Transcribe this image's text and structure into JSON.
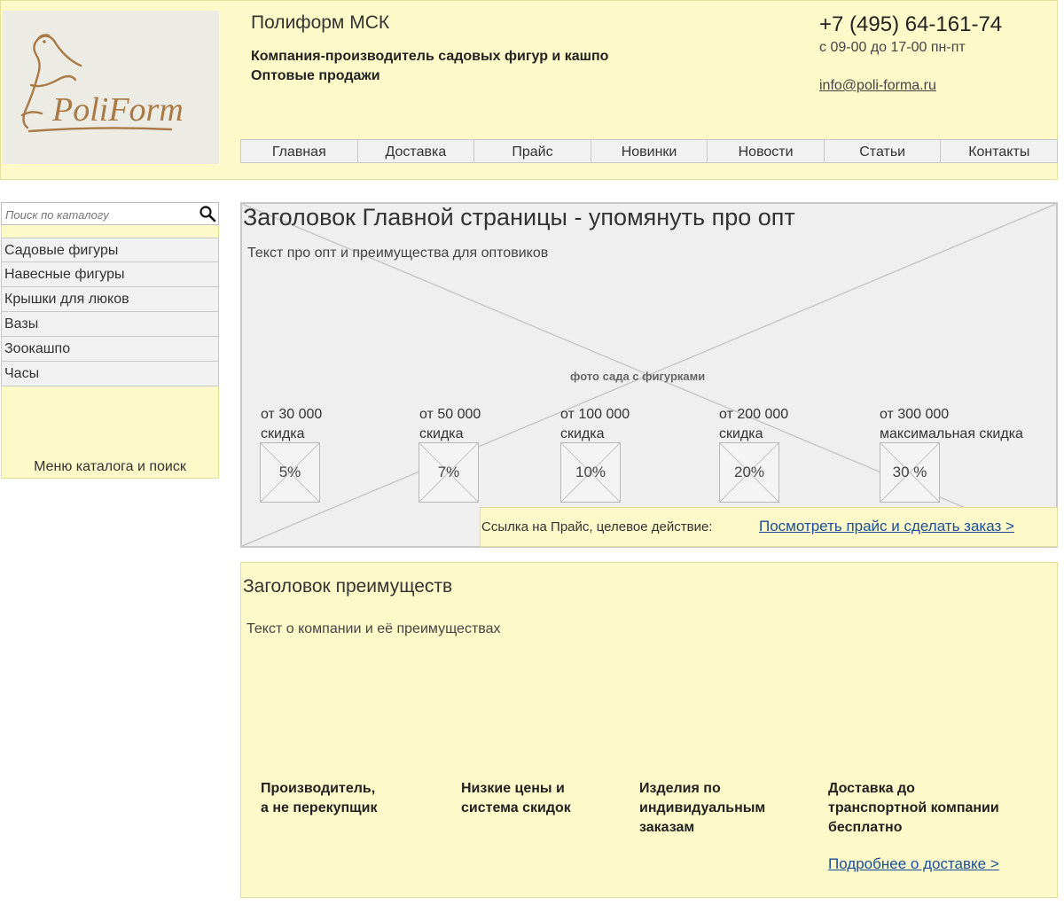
{
  "header": {
    "logo_text": "PoliForm",
    "company_name": "Полиформ МСК",
    "tagline_line1": "Компания-производитель садовых фигур и кашпо",
    "tagline_line2": "Оптовые продажи",
    "phone": "+7 (495) 64-161-74",
    "hours": "с 09-00 до 17-00 пн-пт",
    "email": "info@poli-forma.ru",
    "nav": [
      {
        "label": "Главная"
      },
      {
        "label": "Доставка"
      },
      {
        "label": "Прайс"
      },
      {
        "label": "Новинки"
      },
      {
        "label": "Новости"
      },
      {
        "label": "Статьи"
      },
      {
        "label": "Контакты"
      }
    ]
  },
  "sidebar": {
    "search_placeholder": "Поиск по каталогу",
    "items": [
      {
        "label": "Садовые фигуры"
      },
      {
        "label": "Навесные фигуры"
      },
      {
        "label": "Крышки для люков"
      },
      {
        "label": "Вазы"
      },
      {
        "label": "Зоокашпо"
      },
      {
        "label": "Часы"
      }
    ],
    "caption": "Меню каталога и поиск"
  },
  "hero": {
    "title": "Заголовок Главной страницы - упомянуть про опт",
    "text": "Текст про опт и преимущества для оптовиков",
    "photo_label": "фото сада с фигурками",
    "tiers": [
      {
        "amount": "от 30 000",
        "note": "скидка",
        "discount": "5%"
      },
      {
        "amount": "от 50 000",
        "note": "скидка",
        "discount": "7%"
      },
      {
        "amount": "от 100 000",
        "note": "скидка",
        "discount": "10%"
      },
      {
        "amount": "от 200 000",
        "note": "скидка",
        "discount": "20%"
      },
      {
        "amount": "от 300 000",
        "note": "максимальная скидка",
        "discount": "30 %"
      }
    ],
    "cta_label": "Ссылка на Прайс, целевое действие:",
    "cta_link": "Посмотреть прайс и сделать заказ >"
  },
  "advantages": {
    "title": "Заголовок преимуществ",
    "text": "Текст о компании и её преимуществах",
    "items": [
      {
        "line1": "Производитель,",
        "line2": "а не перекупщик",
        "line3": ""
      },
      {
        "line1": "Низкие цены и",
        "line2": "система скидок",
        "line3": ""
      },
      {
        "line1": "Изделия по",
        "line2": "индивидуальным",
        "line3": "заказам"
      },
      {
        "line1": "Доставка до",
        "line2": "транспортной компании",
        "line3": "бесплатно"
      }
    ],
    "delivery_link": "Подробнее о доставке >"
  }
}
